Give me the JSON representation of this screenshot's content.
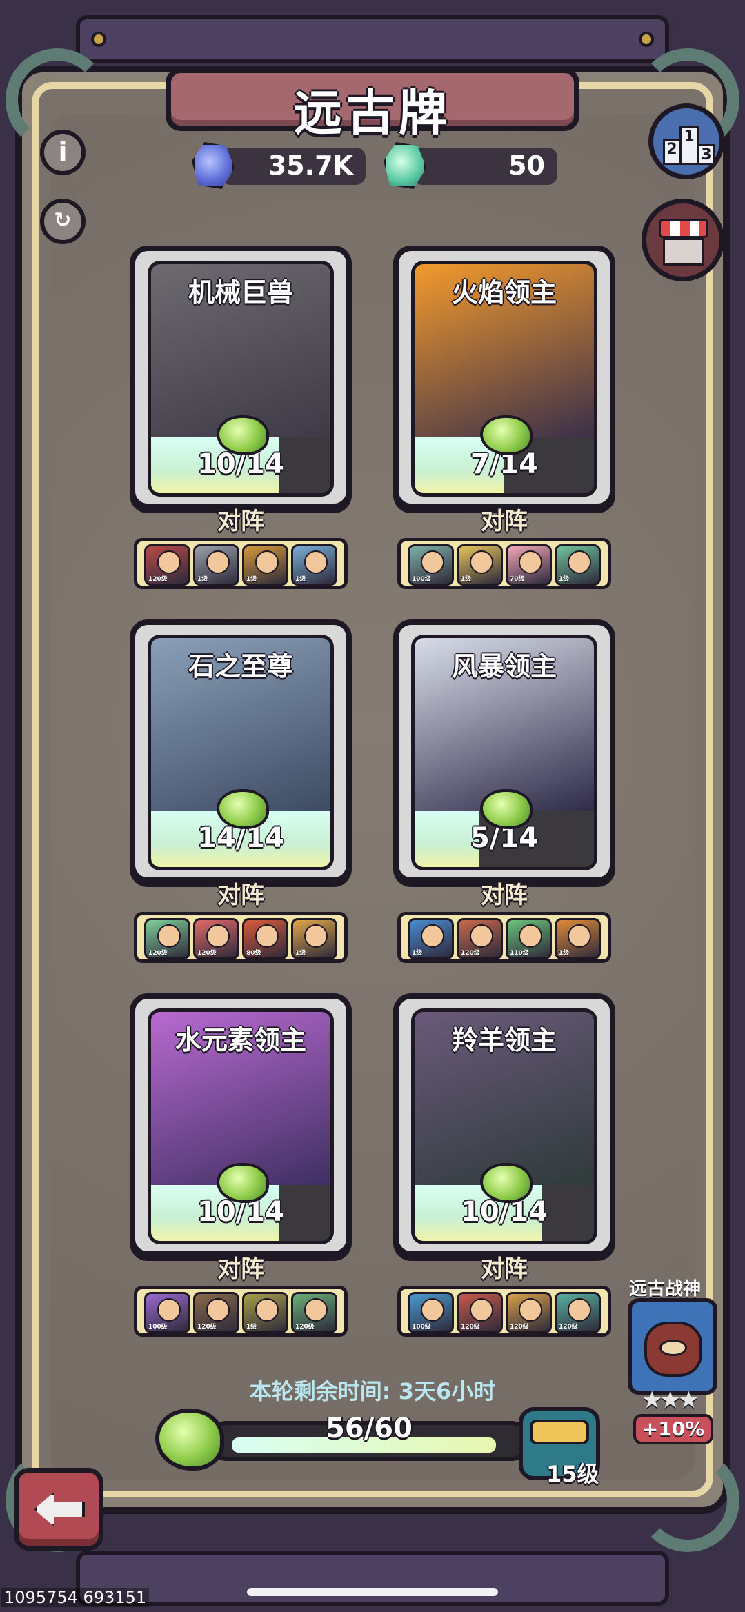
{
  "title": "远古牌",
  "currencies": [
    {
      "icon": "blue-gem-icon",
      "value": "35.7K"
    },
    {
      "icon": "green-gem-icon",
      "value": "50"
    }
  ],
  "side_buttons": {
    "info": "i",
    "refresh_icon": "refresh-icon",
    "rank_labels": [
      "2",
      "1",
      "3"
    ],
    "shop_icon": "shop-icon"
  },
  "cards": [
    {
      "name": "机械巨兽",
      "count": "10/14",
      "progress": 0.714,
      "vs": "对阵",
      "art_colors": [
        "#6e6a70",
        "#3e3a46"
      ],
      "team": [
        {
          "color": "#b84a4a",
          "lv": "120级"
        },
        {
          "color": "#9aa0a8",
          "lv": "1级"
        },
        {
          "color": "#d59a3a",
          "lv": "1级"
        },
        {
          "color": "#7aaed8",
          "lv": "1级"
        }
      ]
    },
    {
      "name": "火焰领主",
      "count": "7/14",
      "progress": 0.5,
      "vs": "对阵",
      "art_colors": [
        "#f39a2c",
        "#3a2f4a"
      ],
      "team": [
        {
          "color": "#7fb0a8",
          "lv": "100级"
        },
        {
          "color": "#e6c45a",
          "lv": "1级"
        },
        {
          "color": "#f2a7b8",
          "lv": "70级"
        },
        {
          "color": "#6fc39a",
          "lv": "1级"
        }
      ]
    },
    {
      "name": "石之至尊",
      "count": "14/14",
      "progress": 1.0,
      "vs": "对阵",
      "art_colors": [
        "#8aa0b8",
        "#3d4a62"
      ],
      "team": [
        {
          "color": "#7fcf9a",
          "lv": "120级"
        },
        {
          "color": "#e06a6a",
          "lv": "120级"
        },
        {
          "color": "#d85a3a",
          "lv": "80级"
        },
        {
          "color": "#e0a64a",
          "lv": "1级"
        }
      ]
    },
    {
      "name": "风暴领主",
      "count": "5/14",
      "progress": 0.357,
      "vs": "对阵",
      "art_colors": [
        "#d8dde8",
        "#2e2a48"
      ],
      "team": [
        {
          "color": "#4a8ad0",
          "lv": "1级"
        },
        {
          "color": "#c86a4a",
          "lv": "120级"
        },
        {
          "color": "#6cc37a",
          "lv": "110级"
        },
        {
          "color": "#e08a3a",
          "lv": "1级"
        }
      ]
    },
    {
      "name": "水元素领主",
      "count": "10/14",
      "progress": 0.714,
      "vs": "对阵",
      "art_colors": [
        "#b86ad0",
        "#3e2f62"
      ],
      "team": [
        {
          "color": "#9a6ad0",
          "lv": "100级"
        },
        {
          "color": "#8a6a4a",
          "lv": "120级"
        },
        {
          "color": "#a8a04a",
          "lv": "1级"
        },
        {
          "color": "#6ab07a",
          "lv": "120级"
        }
      ]
    },
    {
      "name": "羚羊领主",
      "count": "10/14",
      "progress": 0.714,
      "vs": "对阵",
      "art_colors": [
        "#6a5a7a",
        "#2e3a3a"
      ],
      "team": [
        {
          "color": "#4a9ad0",
          "lv": "100级"
        },
        {
          "color": "#c85a4a",
          "lv": "120级"
        },
        {
          "color": "#d8a04a",
          "lv": "120级"
        },
        {
          "color": "#5ab0a0",
          "lv": "120级"
        }
      ]
    }
  ],
  "timer": "本轮剩余时间: 3天6小时",
  "progress": {
    "text": "56/60",
    "value": 56,
    "max": 60,
    "level": "15级"
  },
  "god": {
    "title": "远古战神",
    "stars": "★★★",
    "bonus": "+10%"
  },
  "debug_ids": "1095754 693151"
}
